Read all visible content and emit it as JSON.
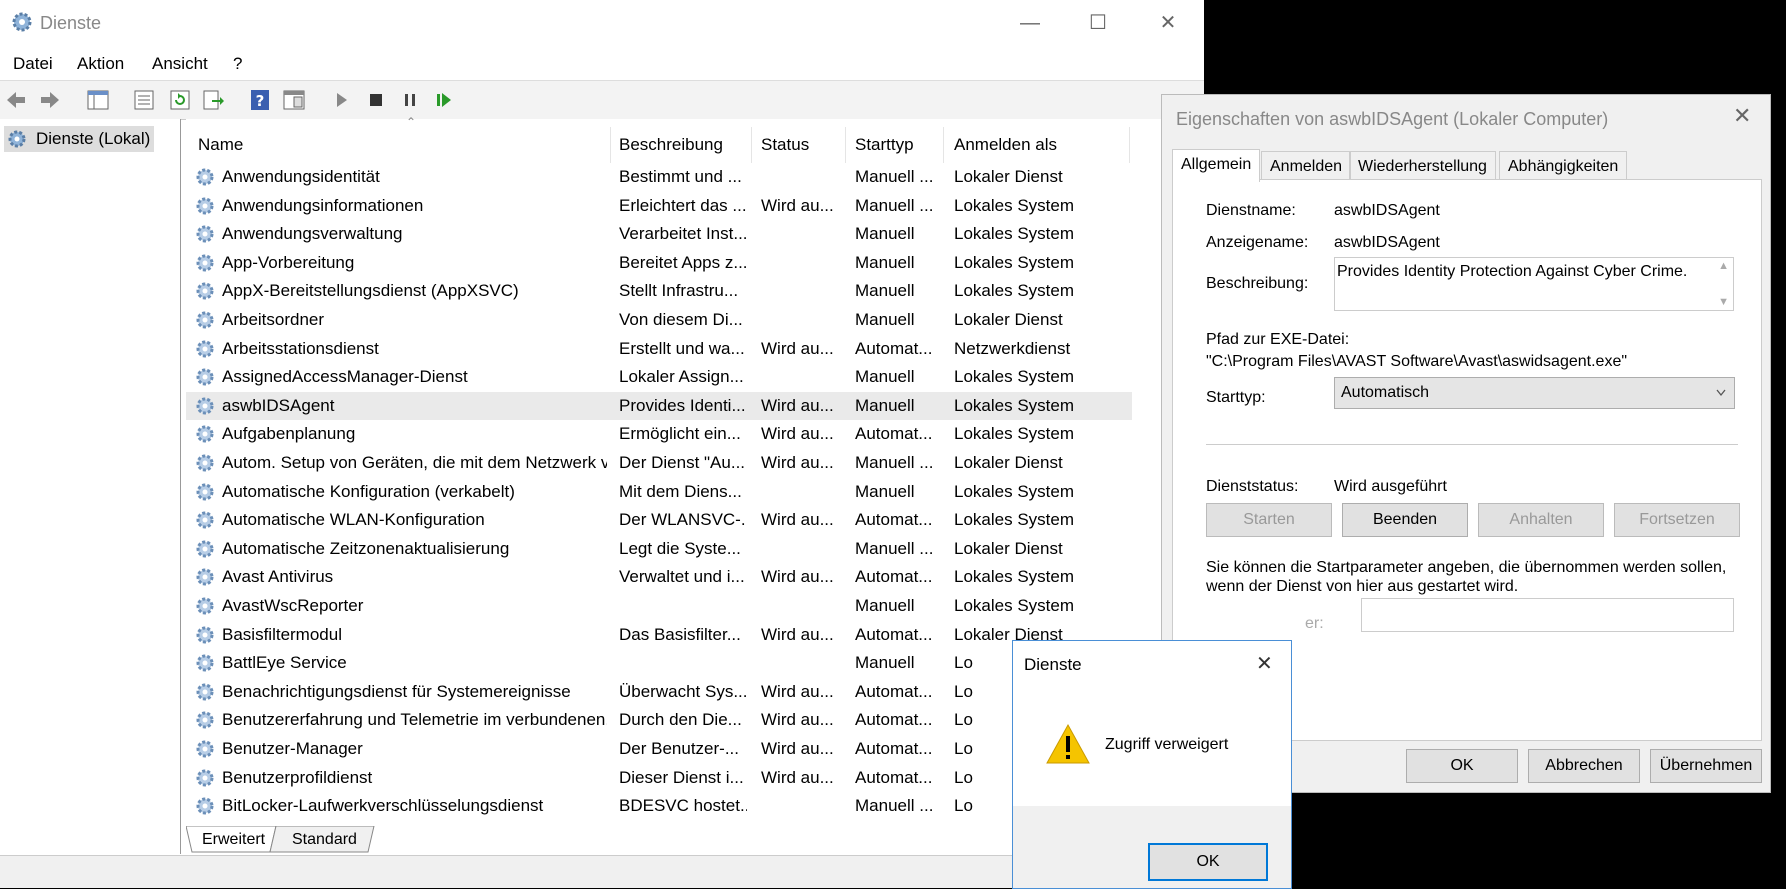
{
  "main_window": {
    "title": "Dienste",
    "menu": [
      "Datei",
      "Aktion",
      "Ansicht",
      "?"
    ],
    "tree_item": "Dienste (Lokal)",
    "columns": [
      "Name",
      "Beschreibung",
      "Status",
      "Starttyp",
      "Anmelden als"
    ],
    "rows": [
      [
        "Anwendungsidentität",
        "Bestimmt und ...",
        "",
        "Manuell ...",
        "Lokaler Dienst"
      ],
      [
        "Anwendungsinformationen",
        "Erleichtert das ...",
        "Wird au...",
        "Manuell ...",
        "Lokales System"
      ],
      [
        "Anwendungsverwaltung",
        "Verarbeitet Inst...",
        "",
        "Manuell",
        "Lokales System"
      ],
      [
        "App-Vorbereitung",
        "Bereitet Apps z...",
        "",
        "Manuell",
        "Lokales System"
      ],
      [
        "AppX-Bereitstellungsdienst (AppXSVC)",
        "Stellt Infrastru...",
        "",
        "Manuell",
        "Lokales System"
      ],
      [
        "Arbeitsordner",
        "Von diesem Di...",
        "",
        "Manuell",
        "Lokaler Dienst"
      ],
      [
        "Arbeitsstationsdienst",
        "Erstellt und wa...",
        "Wird au...",
        "Automat...",
        "Netzwerkdienst"
      ],
      [
        "AssignedAccessManager-Dienst",
        "Lokaler Assign...",
        "",
        "Manuell",
        "Lokales System"
      ],
      [
        "aswbIDSAgent",
        "Provides Identi...",
        "Wird au...",
        "Manuell",
        "Lokales System"
      ],
      [
        "Aufgabenplanung",
        "Ermöglicht ein...",
        "Wird au...",
        "Automat...",
        "Lokales System"
      ],
      [
        "Autom. Setup von Geräten, die mit dem Netzwerk v...",
        "Der Dienst \"Au...",
        "Wird au...",
        "Manuell ...",
        "Lokaler Dienst"
      ],
      [
        "Automatische Konfiguration (verkabelt)",
        "Mit dem Diens...",
        "",
        "Manuell",
        "Lokales System"
      ],
      [
        "Automatische WLAN-Konfiguration",
        "Der WLANSVC-...",
        "Wird au...",
        "Automat...",
        "Lokales System"
      ],
      [
        "Automatische Zeitzonenaktualisierung",
        "Legt die Syste...",
        "",
        "Manuell ...",
        "Lokaler Dienst"
      ],
      [
        "Avast Antivirus",
        "Verwaltet und i...",
        "Wird au...",
        "Automat...",
        "Lokales System"
      ],
      [
        "AvastWscReporter",
        "",
        "",
        "Manuell",
        "Lokales System"
      ],
      [
        "Basisfiltermodul",
        "Das Basisfilter...",
        "Wird au...",
        "Automat...",
        "Lokaler Dienst"
      ],
      [
        "BattlEye Service",
        "",
        "",
        "Manuell",
        "Lo"
      ],
      [
        "Benachrichtigungsdienst für Systemereignisse",
        "Überwacht Sys...",
        "Wird au...",
        "Automat...",
        "Lo"
      ],
      [
        "Benutzererfahrung und Telemetrie im verbundenen...",
        "Durch den Die...",
        "Wird au...",
        "Automat...",
        "Lo"
      ],
      [
        "Benutzer-Manager",
        "Der Benutzer-...",
        "Wird au...",
        "Automat...",
        "Lo"
      ],
      [
        "Benutzerprofildienst",
        "Dieser Dienst i...",
        "Wird au...",
        "Automat...",
        "Lo"
      ],
      [
        "BitLocker-Laufwerkverschlüsselungsdienst",
        "BDESVC hostet...",
        "",
        "Manuell ...",
        "Lo"
      ]
    ],
    "selected_row": 8,
    "view_tabs": [
      "Erweitert",
      "Standard"
    ]
  },
  "properties_dialog": {
    "title": "Eigenschaften von aswbIDSAgent (Lokaler Computer)",
    "tabs": [
      "Allgemein",
      "Anmelden",
      "Wiederherstellung",
      "Abhängigkeiten"
    ],
    "service_name_label": "Dienstname:",
    "service_name": "aswbIDSAgent",
    "display_name_label": "Anzeigename:",
    "display_name": "aswbIDSAgent",
    "description_label": "Beschreibung:",
    "description": "Provides Identity Protection Against Cyber Crime.",
    "path_label": "Pfad zur EXE-Datei:",
    "path": "\"C:\\Program Files\\AVAST Software\\Avast\\aswidsagent.exe\"",
    "starttype_label": "Starttyp:",
    "starttype": "Automatisch",
    "status_label": "Dienststatus:",
    "status": "Wird ausgeführt",
    "buttons": [
      "Starten",
      "Beenden",
      "Anhalten",
      "Fortsetzen"
    ],
    "hint": "Sie können die Startparameter angeben, die übernommen werden sollen, wenn der Dienst von hier aus gestartet wird.",
    "param_label_partial": "er:",
    "footer": [
      "OK",
      "Abbrechen",
      "Übernehmen"
    ]
  },
  "alert_dialog": {
    "title": "Dienste",
    "message": "Zugriff verweigert",
    "ok": "OK"
  }
}
